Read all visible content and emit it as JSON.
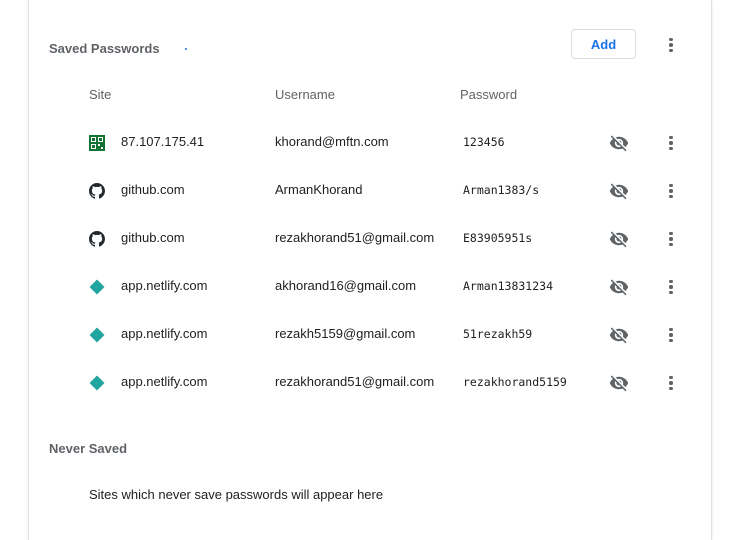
{
  "saved_passwords": {
    "title": "Saved Passwords",
    "add_label": "Add",
    "columns": {
      "site": "Site",
      "username": "Username",
      "password": "Password"
    },
    "rows": [
      {
        "site": "87.107.175.41",
        "username": "khorand@mftn.com",
        "password": "123456",
        "icon": "qr-site-icon"
      },
      {
        "site": "github.com",
        "username": "ArmanKhorand",
        "password": "Arman1383/s",
        "icon": "github-icon"
      },
      {
        "site": "github.com",
        "username": "rezakhorand51@gmail.com",
        "password": "E83905951s",
        "icon": "github-icon"
      },
      {
        "site": "app.netlify.com",
        "username": "akhorand16@gmail.com",
        "password": "Arman13831234",
        "icon": "netlify-icon"
      },
      {
        "site": "app.netlify.com",
        "username": "rezakh5159@gmail.com",
        "password": "51rezakh59",
        "icon": "netlify-icon"
      },
      {
        "site": "app.netlify.com",
        "username": "rezakhorand51@gmail.com",
        "password": "rezakhorand5159",
        "icon": "netlify-icon"
      }
    ]
  },
  "never_saved": {
    "title": "Never Saved",
    "empty_message": "Sites which never save passwords will appear here"
  },
  "colors": {
    "accent": "#1a73e8",
    "netlify": "#20a5a0",
    "qr_green": "#137333"
  }
}
